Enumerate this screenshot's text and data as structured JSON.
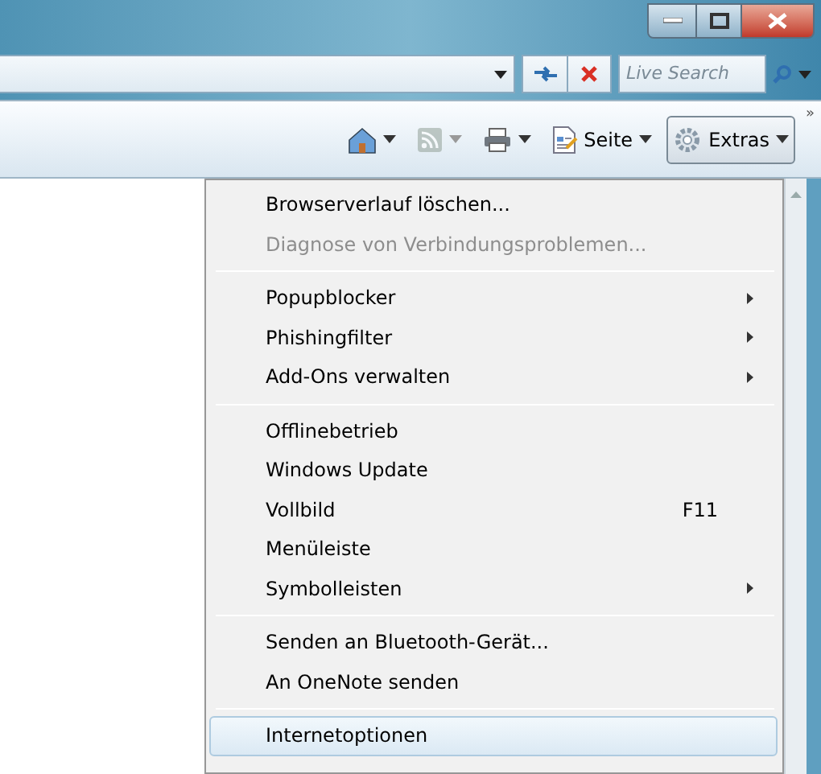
{
  "search": {
    "placeholder": "Live Search"
  },
  "command_bar": [
    {
      "kind": "home",
      "dropdown": true,
      "disabled": false,
      "selected": false
    },
    {
      "kind": "feeds",
      "dropdown": true,
      "disabled": true,
      "selected": false
    },
    {
      "kind": "print",
      "dropdown": true,
      "disabled": false,
      "selected": false
    },
    {
      "kind": "page",
      "label": "Seite",
      "dropdown": true,
      "disabled": false,
      "selected": false
    },
    {
      "kind": "tools",
      "label": "Extras",
      "dropdown": true,
      "disabled": false,
      "selected": true
    }
  ],
  "chevron": "»",
  "menu": [
    {
      "kind": "item",
      "label": "Browserverlauf löschen...",
      "disabled": false,
      "submenu": false,
      "selected": false
    },
    {
      "kind": "item",
      "label": "Diagnose von Verbindungsproblemen...",
      "disabled": true,
      "submenu": false,
      "selected": false
    },
    {
      "kind": "separator"
    },
    {
      "kind": "item",
      "label": "Popupblocker",
      "disabled": false,
      "submenu": true,
      "selected": false
    },
    {
      "kind": "item",
      "label": "Phishingfilter",
      "disabled": false,
      "submenu": true,
      "selected": false
    },
    {
      "kind": "item",
      "label": "Add-Ons verwalten",
      "disabled": false,
      "submenu": true,
      "selected": false
    },
    {
      "kind": "separator"
    },
    {
      "kind": "item",
      "label": "Offlinebetrieb",
      "disabled": false,
      "submenu": false,
      "selected": false
    },
    {
      "kind": "item",
      "label": "Windows Update",
      "disabled": false,
      "submenu": false,
      "selected": false
    },
    {
      "kind": "item",
      "label": "Vollbild",
      "shortcut": "F11",
      "disabled": false,
      "submenu": false,
      "selected": false
    },
    {
      "kind": "item",
      "label": "Menüleiste",
      "disabled": false,
      "submenu": false,
      "selected": false
    },
    {
      "kind": "item",
      "label": "Symbolleisten",
      "disabled": false,
      "submenu": true,
      "selected": false
    },
    {
      "kind": "separator"
    },
    {
      "kind": "item",
      "label": "Senden an Bluetooth-Gerät...",
      "disabled": false,
      "submenu": false,
      "selected": false
    },
    {
      "kind": "item",
      "label": "An OneNote senden",
      "disabled": false,
      "submenu": false,
      "selected": false
    },
    {
      "kind": "separator"
    },
    {
      "kind": "item",
      "label": "Internetoptionen",
      "disabled": false,
      "submenu": false,
      "selected": true
    }
  ]
}
